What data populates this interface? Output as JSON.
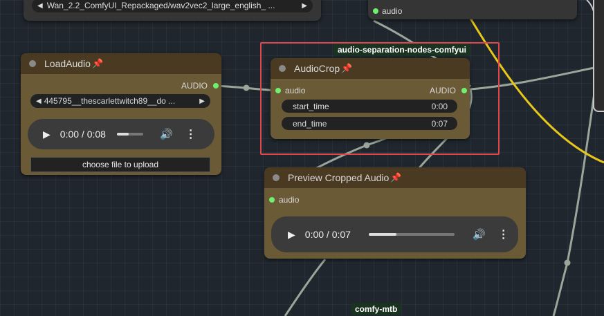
{
  "top_node": {
    "model_value": "Wan_2.2_ComfyUI_Repackaged/wav2vec2_large_english_ ...",
    "output_label": "audio"
  },
  "load_audio": {
    "title": "LoadAudio",
    "output_label": "AUDIO",
    "file_value": "445795__thescarlettwitch89__do ...",
    "player_time": "0:00 / 0:08",
    "upload_label": "choose file to upload"
  },
  "audio_crop": {
    "badge": "audio-separation-nodes-comfyui",
    "title": "AudioCrop",
    "input_label": "audio",
    "output_label": "AUDIO",
    "widgets": [
      {
        "name": "start_time",
        "value": "0:00"
      },
      {
        "name": "end_time",
        "value": "0:07"
      }
    ]
  },
  "preview": {
    "title": "Preview Cropped Audio",
    "input_label": "audio",
    "player_time": "0:00 / 0:07",
    "player_progress": 0.32
  },
  "load_player_progress": 0.45,
  "bottom_badge": "comfy-mtb",
  "colors": {
    "highlight": "#e0474c",
    "node_body": "#6b5a36",
    "node_head": "#4a3a22",
    "link": "#9aa69a",
    "link_yellow": "#e8c61a",
    "slot_dot": "#6ff06f"
  }
}
